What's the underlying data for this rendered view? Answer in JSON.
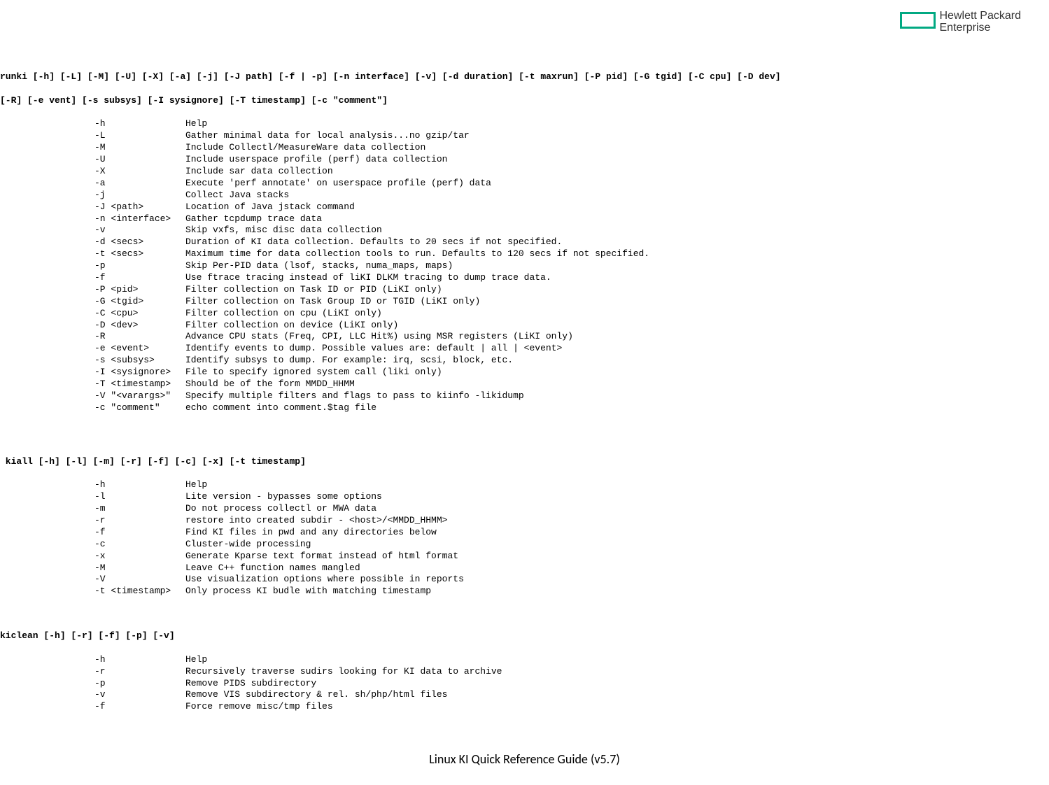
{
  "logo": {
    "line1": "Hewlett Packard",
    "line2": "Enterprise"
  },
  "runki": {
    "usage_line1": "runki [-h] [-L] [-M] [-U] [-X] [-a] [-j] [-J path] [-f | -p] [-n interface] [-v] [-d duration] [-t maxrun] [-P pid] [-G tgid] [-C cpu] [-D dev]",
    "usage_line2": "[-R] [-e vent] [-s subsys] [-I sysignore] [-T timestamp] [-c \"comment\"]",
    "options": [
      {
        "flag": "-h",
        "desc": "Help"
      },
      {
        "flag": "-L",
        "desc": "Gather minimal data for local analysis...no gzip/tar"
      },
      {
        "flag": "-M",
        "desc": "Include Collectl/MeasureWare data collection"
      },
      {
        "flag": "-U",
        "desc": "Include userspace profile (perf) data collection"
      },
      {
        "flag": "-X",
        "desc": "Include sar data collection"
      },
      {
        "flag": "-a",
        "desc": "Execute 'perf annotate' on userspace profile (perf) data"
      },
      {
        "flag": "-j",
        "desc": "Collect Java stacks"
      },
      {
        "flag": "-J <path>",
        "desc": "Location of Java jstack command"
      },
      {
        "flag": "-n <interface>",
        "desc": "Gather tcpdump trace data"
      },
      {
        "flag": "-v",
        "desc": "Skip vxfs, misc disc data collection"
      },
      {
        "flag": "-d <secs>",
        "desc": "Duration of KI data collection. Defaults to 20 secs if not specified."
      },
      {
        "flag": "-t <secs>",
        "desc": "Maximum time for data collection tools to run. Defaults to 120 secs if not specified."
      },
      {
        "flag": "-p",
        "desc": "Skip Per-PID data (lsof, stacks, numa_maps, maps)"
      },
      {
        "flag": "-f",
        "desc": "Use ftrace tracing instead of liKI DLKM tracing to dump trace data."
      },
      {
        "flag": "-P <pid>",
        "desc": "Filter collection on Task ID or PID (LiKI only)"
      },
      {
        "flag": "-G <tgid>",
        "desc": "Filter collection on Task Group ID or TGID (LiKI only)"
      },
      {
        "flag": "-C <cpu>",
        "desc": "Filter collection on cpu (LiKI only)"
      },
      {
        "flag": "-D <dev>",
        "desc": "Filter collection on device (LiKI only)"
      },
      {
        "flag": "-R",
        "desc": "Advance CPU stats (Freq, CPI, LLC Hit%) using MSR registers (LiKI only)"
      },
      {
        "flag": "-e <event>",
        "desc": "Identify events to dump. Possible values are: default | all | <event>"
      },
      {
        "flag": "-s <subsys>",
        "desc": "Identify subsys to dump. For example: irq, scsi, block, etc."
      },
      {
        "flag": "-I <sysignore>",
        "desc": "File to specify ignored system call (liki only)"
      },
      {
        "flag": "-T <timestamp>",
        "desc": "Should be of the form MMDD_HHMM"
      },
      {
        "flag": "-V \"<varargs>\"",
        "desc": "Specify multiple filters and flags to pass to kiinfo -likidump"
      },
      {
        "flag": "-c \"comment\"",
        "desc": "echo comment into comment.$tag file"
      }
    ]
  },
  "kiall": {
    "usage": " kiall [-h] [-l] [-m] [-r] [-f] [-c] [-x] [-t timestamp]",
    "options": [
      {
        "flag": "-h",
        "desc": "Help"
      },
      {
        "flag": "-l",
        "desc": "Lite version - bypasses some options"
      },
      {
        "flag": "-m",
        "desc": "Do not process collectl or MWA data"
      },
      {
        "flag": "-r",
        "desc": "restore into created subdir - <host>/<MMDD_HHMM>"
      },
      {
        "flag": "-f",
        "desc": "Find KI files in pwd and any directories below"
      },
      {
        "flag": "-c",
        "desc": "Cluster-wide processing"
      },
      {
        "flag": "-x",
        "desc": "Generate Kparse text format instead of html format"
      },
      {
        "flag": "-M",
        "desc": "Leave C++ function names mangled"
      },
      {
        "flag": "-V",
        "desc": "Use visualization options where possible in reports"
      },
      {
        "flag": "-t <timestamp>",
        "desc": "Only process KI budle with matching timestamp"
      }
    ]
  },
  "kiclean": {
    "usage": "kiclean [-h] [-r] [-f] [-p] [-v]",
    "options": [
      {
        "flag": "-h",
        "desc": "Help"
      },
      {
        "flag": "-r",
        "desc": "Recursively traverse sudirs looking for KI data to archive"
      },
      {
        "flag": "-p",
        "desc": "Remove PIDS subdirectory"
      },
      {
        "flag": "-v",
        "desc": "Remove VIS subdirectory & rel. sh/php/html files"
      },
      {
        "flag": "-f",
        "desc": "Force remove misc/tmp files"
      }
    ]
  },
  "footer": "Linux KI Quick Reference Guide (v5.7)"
}
